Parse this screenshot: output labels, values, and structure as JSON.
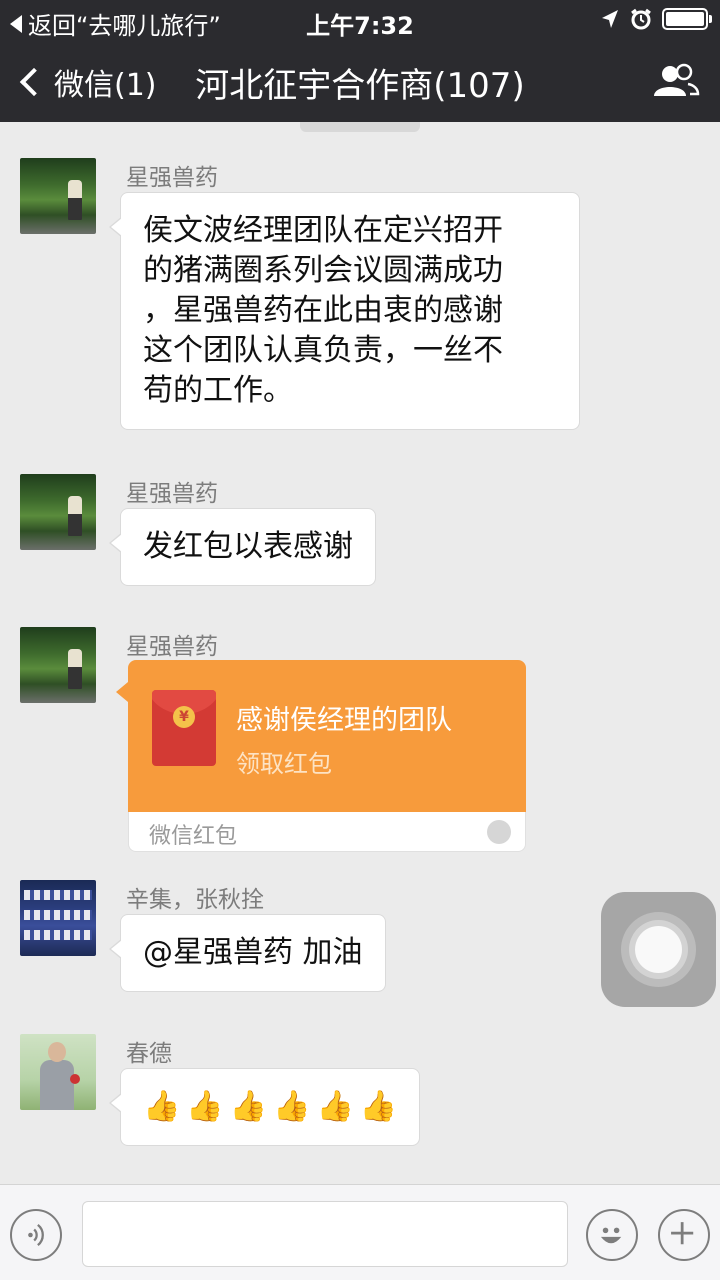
{
  "status_bar": {
    "back_label": "返回“去哪儿旅行”",
    "time": "上午7:32"
  },
  "nav": {
    "back_label": "微信(1)",
    "title": "河北征宇合作商(107)"
  },
  "messages": [
    {
      "sender": "星强兽药",
      "lines": [
        "侯文波经理团队在定兴招开",
        "的猪满圈系列会议圆满成功",
        "，星强兽药在此由衷的感谢",
        "这个团队认真负责，一丝不",
        "苟的工作。"
      ]
    },
    {
      "sender": "星强兽药",
      "text": "发红包以表感谢"
    },
    {
      "sender": "星强兽药",
      "red_packet": {
        "title": "感谢侯经理的团队",
        "action": "领取红包",
        "footer": "微信红包",
        "coin": "¥"
      }
    },
    {
      "sender": "辛集，张秋拴",
      "text": "@星强兽药 加油"
    },
    {
      "sender": "春德",
      "emoji": [
        "👍",
        "👍",
        "👍",
        "👍",
        "👍",
        "👍"
      ]
    }
  ],
  "icons": {
    "status": [
      "location-arrow-icon",
      "alarm-icon",
      "battery-icon"
    ],
    "nav": [
      "chevron-left-icon",
      "group-members-icon"
    ],
    "input": [
      "voice-icon",
      "emoji-icon",
      "plus-icon"
    ]
  },
  "colors": {
    "header_bg": "#2b2b2f",
    "chat_bg": "#ebebeb",
    "red_packet": "#f79b3c",
    "envelope": "#d33a34"
  }
}
